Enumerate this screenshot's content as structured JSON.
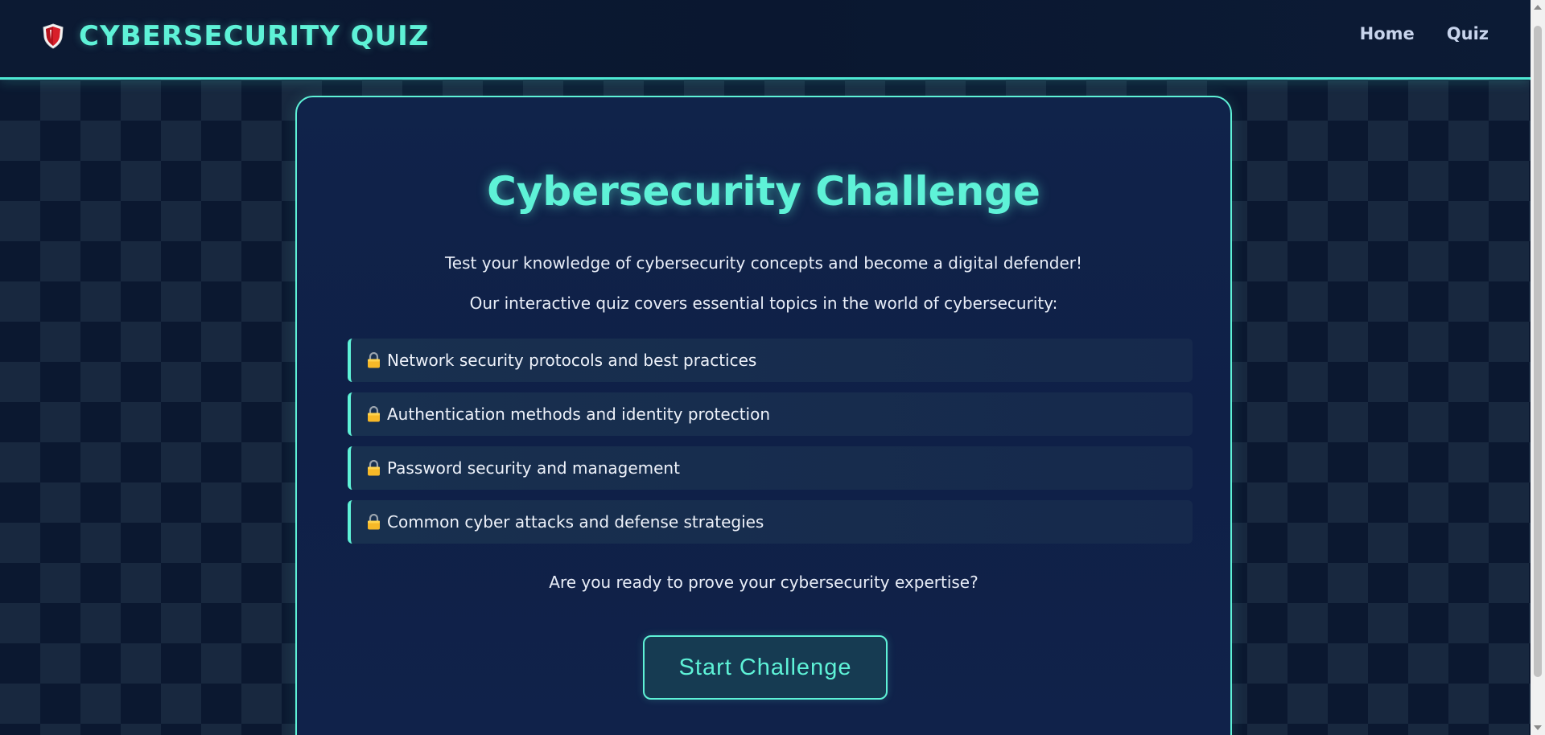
{
  "header": {
    "brand_title": "CYBERSECURITY QUIZ",
    "brand_icon": "shield-icon",
    "nav": [
      {
        "label": "Home"
      },
      {
        "label": "Quiz"
      }
    ]
  },
  "main": {
    "title": "Cybersecurity Challenge",
    "intro_1": "Test your knowledge of cybersecurity concepts and become a digital defender!",
    "intro_2": "Our interactive quiz covers essential topics in the world of cybersecurity:",
    "topics": [
      {
        "icon": "lock-icon",
        "label": "Network security protocols and best practices"
      },
      {
        "icon": "lock-icon",
        "label": "Authentication methods and identity protection"
      },
      {
        "icon": "lock-icon",
        "label": "Password security and management"
      },
      {
        "icon": "lock-icon",
        "label": "Common cyber attacks and defense strategies"
      }
    ],
    "ready_text": "Are you ready to prove your cybersecurity expertise?",
    "start_label": "Start Challenge"
  },
  "colors": {
    "accent": "#5ef2d7",
    "background": "#0b1830",
    "card": "#10234a",
    "text": "#e9eef8"
  }
}
